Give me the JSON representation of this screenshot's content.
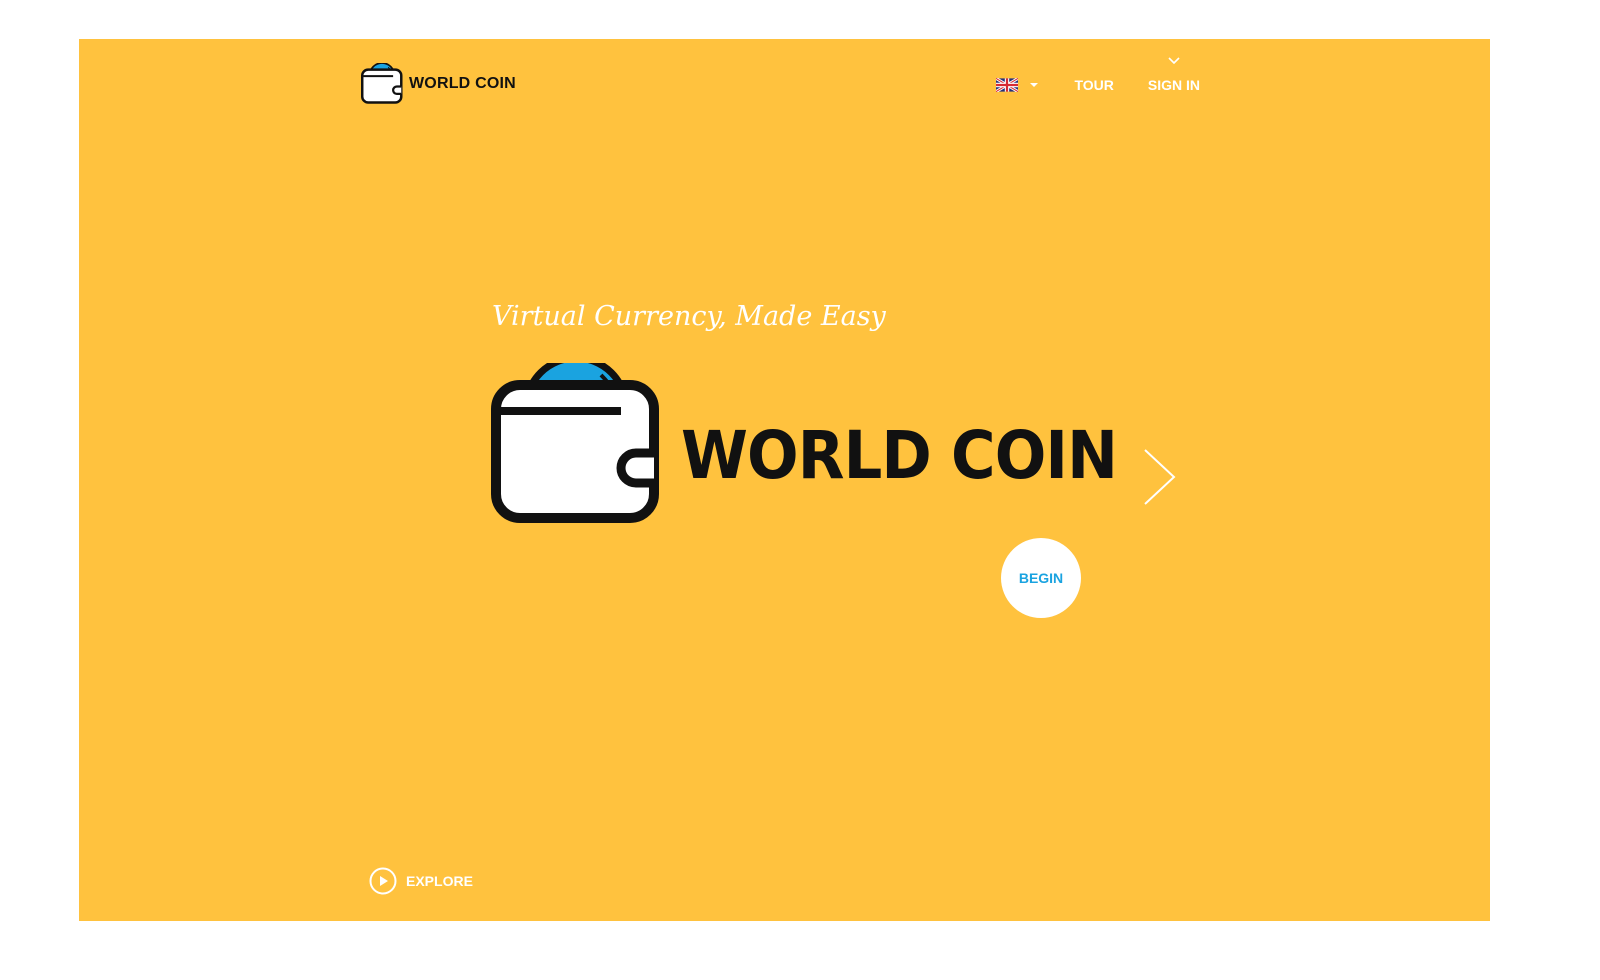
{
  "colors": {
    "background": "#FFC23E",
    "accent": "#1AA3E0",
    "ink": "#111111"
  },
  "header": {
    "logo_text": "WORLD COIN",
    "language": {
      "icon": "uk-flag-icon"
    },
    "nav": {
      "tour": "TOUR",
      "sign_in": "SIGN IN"
    }
  },
  "hero": {
    "tagline": "Virtual Currency, Made Easy",
    "title": "WORLD COIN",
    "begin_label": "BEGIN",
    "next_icon": "chevron-right-icon"
  },
  "footer": {
    "explore_label": "EXPLORE",
    "explore_icon": "play-circle-icon"
  }
}
